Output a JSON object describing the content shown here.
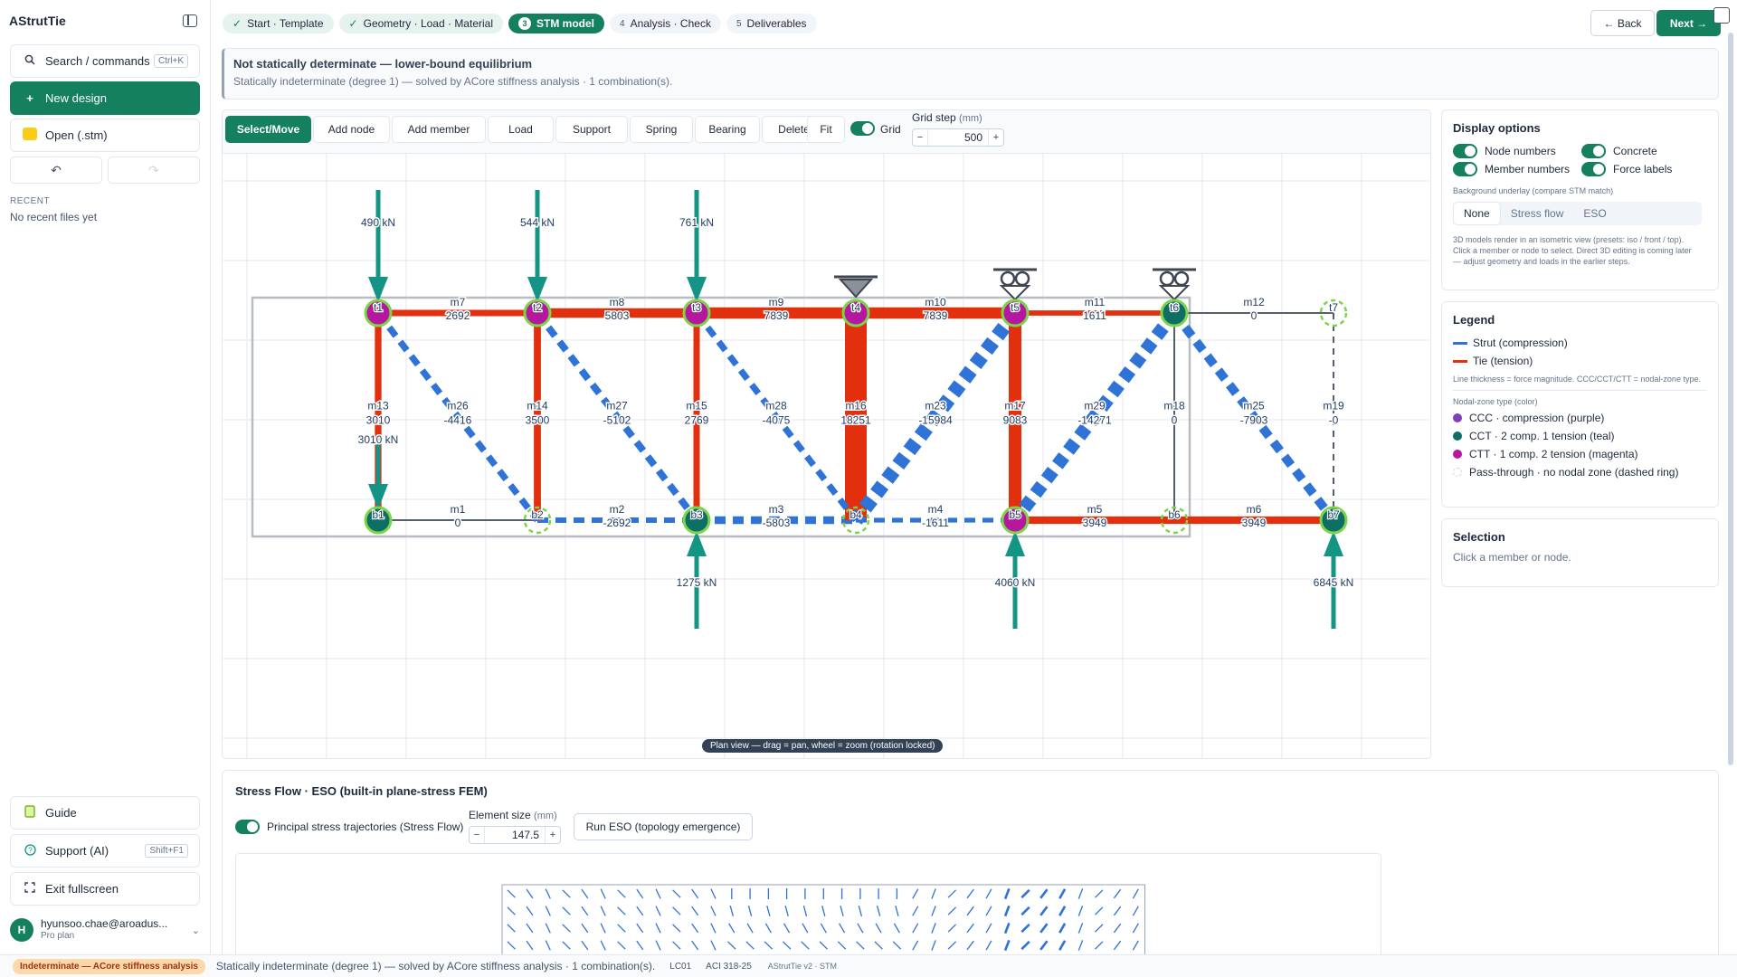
{
  "app": {
    "title": "AStrutTie"
  },
  "sidebar": {
    "search_label": "Search / commands",
    "search_shortcut": "Ctrl+K",
    "new_design_label": "New design",
    "open_label": "Open (.stm)",
    "recent_heading": "RECENT",
    "recent_empty": "No recent files yet",
    "guide_label": "Guide",
    "support_label": "Support (AI)",
    "support_shortcut": "Shift+F1",
    "exit_fullscreen_label": "Exit fullscreen",
    "user_initial": "H",
    "user_email": "hyunsoo.chae@aroadus...",
    "user_plan": "Pro plan"
  },
  "steps": [
    {
      "label": "Start · Template",
      "state": "done"
    },
    {
      "label": "Geometry · Load · Material",
      "state": "done"
    },
    {
      "num": "3",
      "label": "STM model",
      "state": "active"
    },
    {
      "num": "4",
      "label": "Analysis · Check",
      "state": "todo"
    },
    {
      "num": "5",
      "label": "Deliverables",
      "state": "todo"
    }
  ],
  "nav": {
    "back_label": "← Back",
    "next_label": "Next →"
  },
  "banner": {
    "title": "Not statically determinate — lower-bound equilibrium",
    "subtitle": "Statically indeterminate (degree 1) — solved by ACore stiffness analysis · 1 combination(s)."
  },
  "toolbar": {
    "tools": [
      "Select/Move",
      "Add node",
      "Add member",
      "Load",
      "Support",
      "Spring",
      "Bearing",
      "Delete"
    ],
    "fit_label": "Fit",
    "grid_label": "Grid",
    "grid_step_label": "Grid step",
    "grid_step_unit": "(mm)",
    "grid_step_value": "500",
    "minus": "−",
    "plus": "+"
  },
  "model": {
    "nodes": [
      {
        "id": "t1",
        "x": 0,
        "y": 1,
        "type": "CTT"
      },
      {
        "id": "t2",
        "x": 1,
        "y": 1,
        "type": "CTT"
      },
      {
        "id": "t3",
        "x": 2,
        "y": 1,
        "type": "CTT"
      },
      {
        "id": "t4",
        "x": 3,
        "y": 1,
        "type": "CTT"
      },
      {
        "id": "t5",
        "x": 4,
        "y": 1,
        "type": "CTT"
      },
      {
        "id": "t6",
        "x": 5,
        "y": 1,
        "type": "CCT"
      },
      {
        "id": "t7",
        "x": 6,
        "y": 1,
        "type": "pass"
      },
      {
        "id": "b1",
        "x": 0,
        "y": 0,
        "type": "CCT"
      },
      {
        "id": "b2",
        "x": 1,
        "y": 0,
        "type": "pass"
      },
      {
        "id": "b3",
        "x": 2,
        "y": 0,
        "type": "CCT"
      },
      {
        "id": "b4",
        "x": 3,
        "y": 0,
        "type": "pass"
      },
      {
        "id": "b5",
        "x": 4,
        "y": 0,
        "type": "CTT"
      },
      {
        "id": "b6",
        "x": 5,
        "y": 0,
        "type": "pass"
      },
      {
        "id": "b7",
        "x": 6,
        "y": 0,
        "type": "CCT"
      }
    ],
    "members": [
      {
        "id": "m1",
        "a": "b1",
        "b": "b2",
        "force": "0"
      },
      {
        "id": "m2",
        "a": "b2",
        "b": "b3",
        "force": "-2692"
      },
      {
        "id": "m3",
        "a": "b3",
        "b": "b4",
        "force": "-5803"
      },
      {
        "id": "m4",
        "a": "b4",
        "b": "b5",
        "force": "-1611"
      },
      {
        "id": "m5",
        "a": "b5",
        "b": "b6",
        "force": "3949"
      },
      {
        "id": "m6",
        "a": "b6",
        "b": "b7",
        "force": "3949"
      },
      {
        "id": "m7",
        "a": "t1",
        "b": "t2",
        "force": "2692"
      },
      {
        "id": "m8",
        "a": "t2",
        "b": "t3",
        "force": "5803"
      },
      {
        "id": "m9",
        "a": "t3",
        "b": "t4",
        "force": "7839"
      },
      {
        "id": "m10",
        "a": "t4",
        "b": "t5",
        "force": "7839"
      },
      {
        "id": "m11",
        "a": "t5",
        "b": "t6",
        "force": "1611"
      },
      {
        "id": "m12",
        "a": "t6",
        "b": "t7",
        "force": "0"
      },
      {
        "id": "m13",
        "a": "t1",
        "b": "b1",
        "force": "3010"
      },
      {
        "id": "m14",
        "a": "t2",
        "b": "b2",
        "force": "3500"
      },
      {
        "id": "m15",
        "a": "t3",
        "b": "b3",
        "force": "2769"
      },
      {
        "id": "m16",
        "a": "t4",
        "b": "b4",
        "force": "18251"
      },
      {
        "id": "m17",
        "a": "t5",
        "b": "b5",
        "force": "9083"
      },
      {
        "id": "m18",
        "a": "t6",
        "b": "b6",
        "force": "0"
      },
      {
        "id": "m19",
        "a": "t7",
        "b": "b7",
        "force": "-0"
      },
      {
        "id": "m26",
        "a": "t1",
        "b": "b2",
        "force": "-4416"
      },
      {
        "id": "m27",
        "a": "t2",
        "b": "b3",
        "force": "-5102"
      },
      {
        "id": "m28",
        "a": "t3",
        "b": "b4",
        "force": "-4075"
      },
      {
        "id": "m23",
        "a": "t5",
        "b": "b4",
        "force": "-15984"
      },
      {
        "id": "m29",
        "a": "t6",
        "b": "b5",
        "force": "-14271"
      },
      {
        "id": "m25",
        "a": "t6",
        "b": "b7",
        "force": "-7903"
      }
    ],
    "loads": [
      {
        "node": "t1",
        "dir": "down",
        "label": "490 kN"
      },
      {
        "node": "t2",
        "dir": "down",
        "label": "544 kN"
      },
      {
        "node": "t3",
        "dir": "down",
        "label": "761 kN"
      },
      {
        "node": "b1",
        "dir": "down",
        "label": "3010 kN"
      },
      {
        "node": "b3",
        "dir": "up",
        "label": "1275 kN"
      },
      {
        "node": "b5",
        "dir": "up",
        "label": "4060 kN"
      },
      {
        "node": "b7",
        "dir": "up",
        "label": "6845 kN"
      }
    ],
    "supports": [
      {
        "node": "t4",
        "kind": "pin"
      },
      {
        "node": "t5",
        "kind": "roller"
      },
      {
        "node": "t6",
        "kind": "roller"
      }
    ],
    "colors": {
      "strut": "#2f73d6",
      "tie": "#e2300f",
      "zero": "#555f6b",
      "ccc": "#7e3fb8",
      "cct": "#0d6e64",
      "ctt": "#b5179e",
      "ring": "#7bd44a",
      "load": "#149484"
    },
    "view_hint": "Plan view — drag = pan, wheel = zoom (rotation locked)"
  },
  "display_options": {
    "title": "Display options",
    "node_numbers": "Node numbers",
    "concrete": "Concrete",
    "member_numbers": "Member numbers",
    "force_labels": "Force labels",
    "underlay_label": "Background underlay (compare STM match)",
    "underlay_options": [
      "None",
      "Stress flow",
      "ESO"
    ],
    "underlay_selected": "None",
    "note": "3D models render in an isometric view (presets: iso / front / top). Click a member or node to select. Direct 3D editing is coming later — adjust geometry and loads in the earlier steps."
  },
  "legend": {
    "title": "Legend",
    "strut": "Strut (compression)",
    "tie": "Tie (tension)",
    "thickness_note": "Line thickness = force magnitude. CCC/CCT/CTT = nodal-zone type.",
    "nodal_heading": "Nodal-zone type (color)",
    "ccc": "CCC · compression (purple)",
    "cct": "CCT · 2 comp. 1 tension (teal)",
    "ctt": "CTT · 1 comp. 2 tension (magenta)",
    "pass": "Pass-through · no nodal zone (dashed ring)"
  },
  "selection": {
    "title": "Selection",
    "hint": "Click a member or node."
  },
  "stress": {
    "title": "Stress Flow · ESO (built-in plane-stress FEM)",
    "trajectories_label": "Principal stress trajectories (Stress Flow)",
    "element_size_label": "Element size",
    "element_size_unit": "(mm)",
    "element_size_value": "147.5",
    "run_label": "Run ESO (topology emergence)"
  },
  "status": {
    "badge": "Indeterminate — ACore stiffness analysis",
    "text": "Statically indeterminate (degree 1) — solved by ACore stiffness analysis · 1 combination(s).",
    "lc": "LC01",
    "code": "ACI 318-25",
    "version": "AStrutTie v2 · STM"
  }
}
